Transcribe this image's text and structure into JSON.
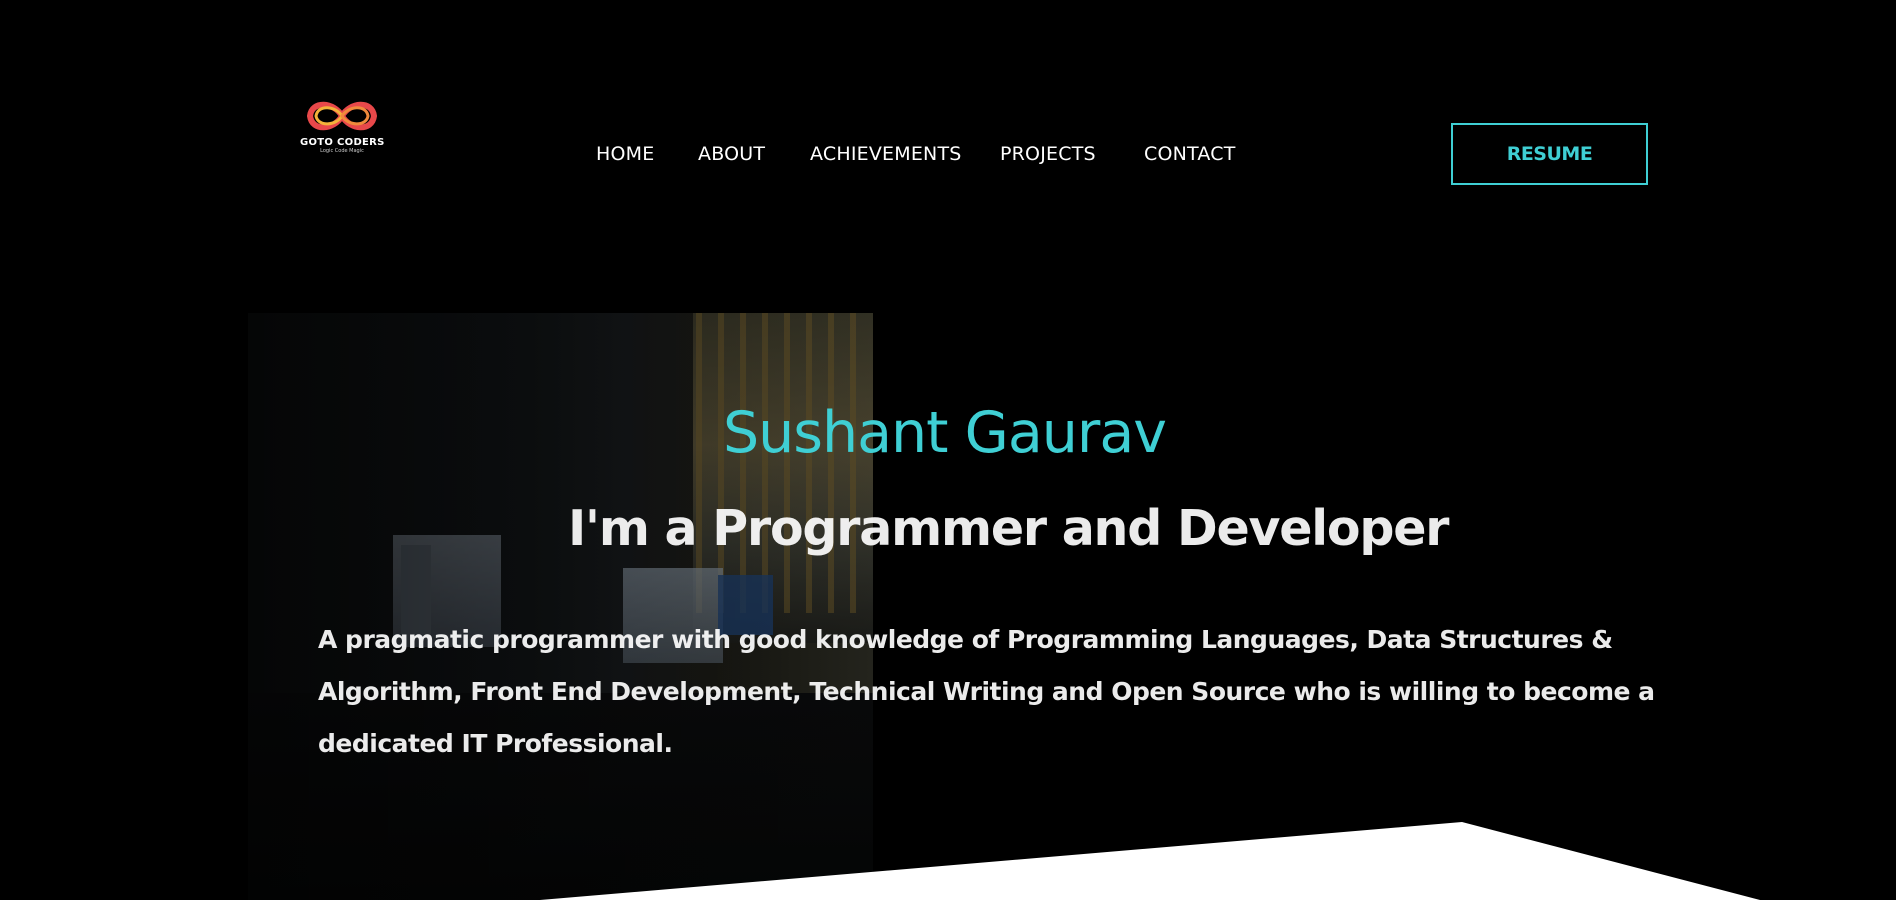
{
  "header": {
    "logo": {
      "title": "GOTO CODERS",
      "tagline": "Logic Code Magic"
    },
    "nav": [
      {
        "label": "HOME"
      },
      {
        "label": "ABOUT"
      },
      {
        "label": "ACHIEVEMENTS"
      },
      {
        "label": "PROJECTS"
      },
      {
        "label": "CONTACT"
      }
    ],
    "resume_label": "RESUME"
  },
  "hero": {
    "name": "Sushant Gaurav",
    "subtitle": "I'm a Programmer and Developer",
    "description_lines": [
      "A pragmatic programmer with good knowledge of Programming Languages, Data Structures &",
      "Algorithm, Front End Development, Technical Writing and Open Source who is willing to become a",
      "dedicated IT Professional."
    ]
  },
  "colors": {
    "background": "#000000",
    "accent": "#3fcfd4",
    "text": "#ffffff"
  }
}
